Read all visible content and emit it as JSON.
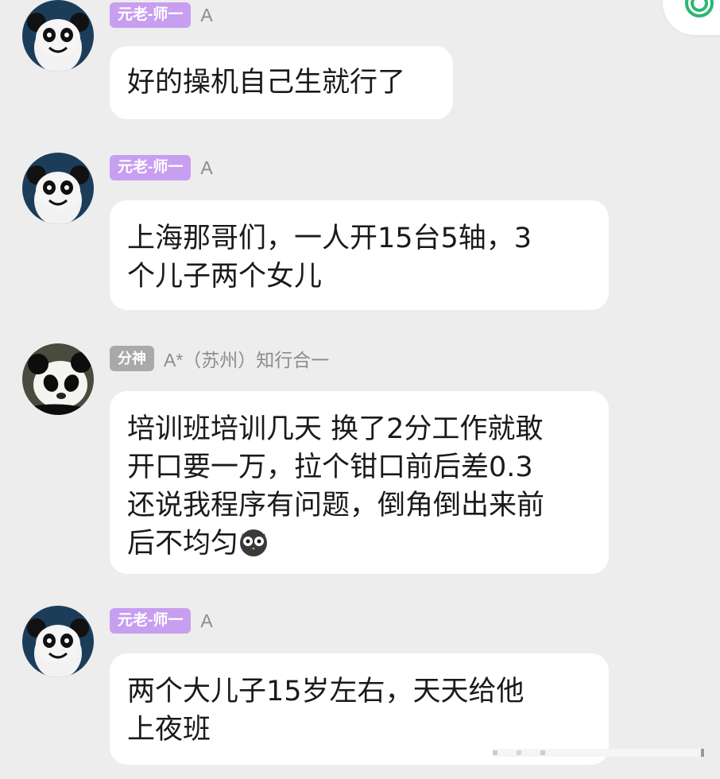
{
  "messages": [
    {
      "avatar": "panda-cartoon-avatar",
      "badge": "元老-师一",
      "sender": "A",
      "text": "好的操机自己生就行了"
    },
    {
      "avatar": "panda-cartoon-avatar",
      "badge": "元老-师一",
      "sender": "A",
      "text": "上海那哥们，一人开15台5轴，3\n个儿子两个女儿"
    },
    {
      "avatar": "panda-photo-avatar",
      "badge": "分神",
      "sender": "A*（苏州）知行合一",
      "text": "培训班培训几天 换了2分工作就敢\n开口要一万，拉个钳口前后差0.3\n还说我程序有问题，倒角倒出来前\n后不均匀",
      "emoji": "owl-emoji"
    },
    {
      "avatar": "panda-cartoon-avatar",
      "badge": "元老-师一",
      "sender": "A",
      "text": "两个大儿子15岁左右，天天给他\n上夜班"
    }
  ],
  "colors": {
    "background": "#ededed",
    "bubble": "#ffffff",
    "badge_purple": "#c79ef0",
    "badge_gray": "#a9a9a9",
    "accent_green": "#2bb673"
  },
  "icons": {
    "top_right": "app-logo-icon"
  }
}
